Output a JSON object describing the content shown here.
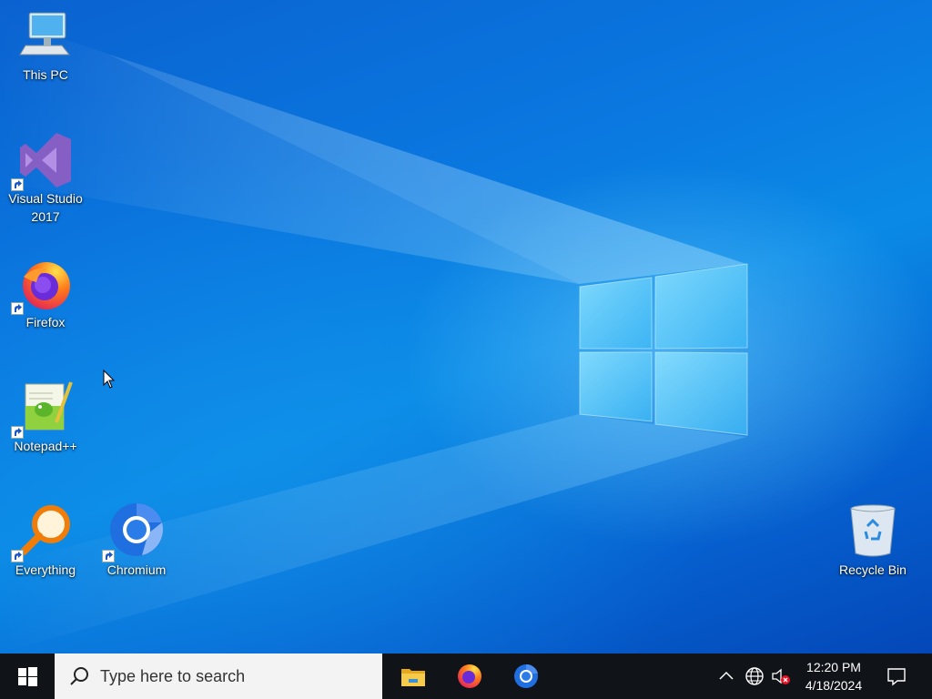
{
  "desktop": {
    "icons": [
      {
        "label_lines": [
          "This PC"
        ],
        "icon": "computer-icon",
        "shortcut": false
      },
      {
        "label_lines": [
          "Visual Studio",
          "2017"
        ],
        "icon": "visual-studio-icon",
        "shortcut": true
      },
      {
        "label_lines": [
          "Firefox"
        ],
        "icon": "firefox-icon",
        "shortcut": true
      },
      {
        "label_lines": [
          "Notepad++"
        ],
        "icon": "notepad-plus-plus-icon",
        "shortcut": true
      },
      {
        "label_lines": [
          "Everything"
        ],
        "icon": "everything-search-icon",
        "shortcut": true
      },
      {
        "label_lines": [
          "Chromium"
        ],
        "icon": "chromium-icon",
        "shortcut": true
      },
      {
        "label_lines": [
          "Recycle Bin"
        ],
        "icon": "recycle-bin-icon",
        "shortcut": false
      }
    ]
  },
  "taskbar": {
    "start_icon": "windows-logo-icon",
    "search_placeholder": "Type here to search",
    "pinned_apps": [
      "file-explorer-icon",
      "firefox-icon",
      "chromium-icon"
    ],
    "tray_icons": [
      "chevron-up-icon",
      "network-globe-icon",
      "speaker-muted-icon"
    ],
    "clock": {
      "time": "12:20 PM",
      "date": "4/18/2024"
    },
    "notification_icon": "action-center-icon"
  },
  "colors": {
    "desktop_blue": "#0a78e0",
    "taskbar": "#101318",
    "search_box": "#f3f3f3"
  }
}
